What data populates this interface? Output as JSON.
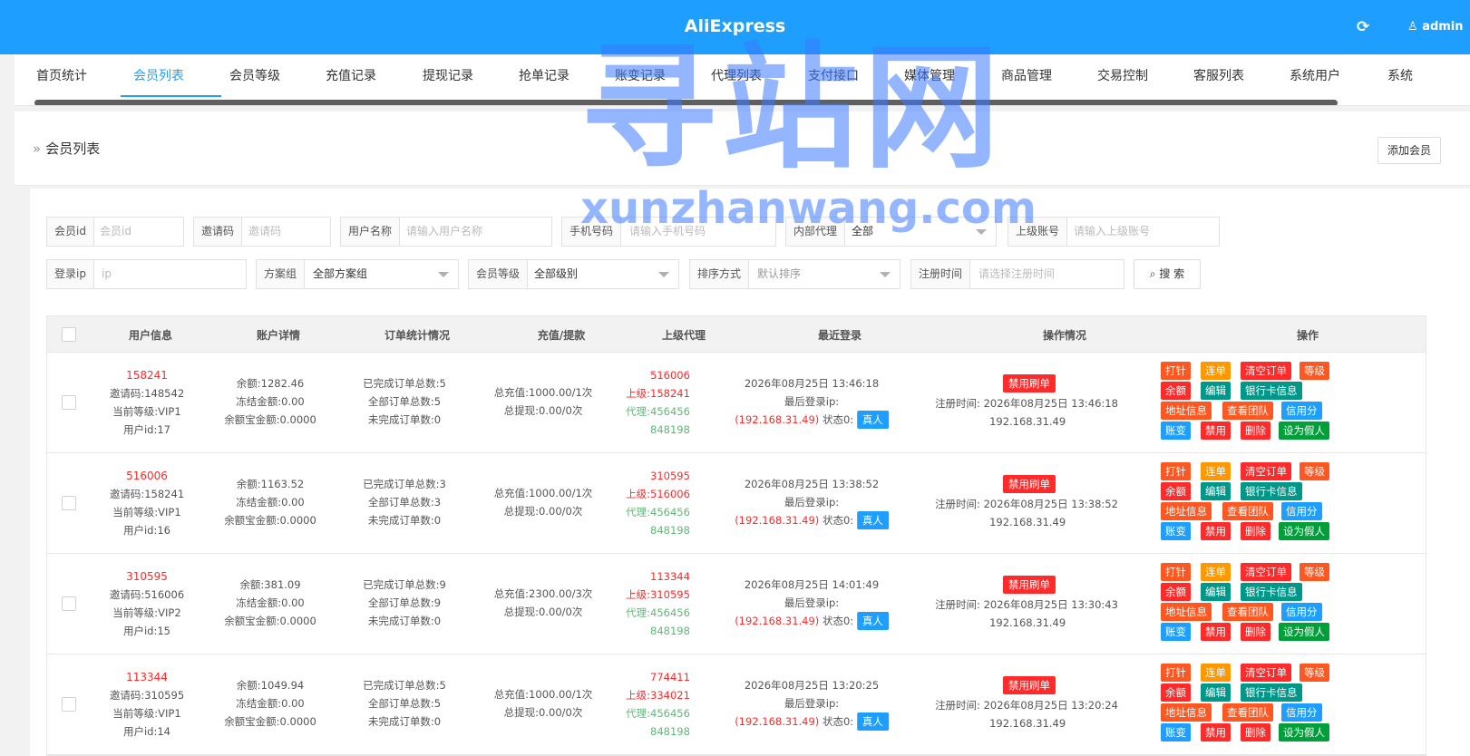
{
  "app": {
    "title": "AliExpress",
    "user": "admin",
    "refresh_icon": "refresh-icon",
    "user_icon": "user-icon"
  },
  "tabs": [
    "首页统计",
    "会员列表",
    "会员等级",
    "充值记录",
    "提现记录",
    "抢单记录",
    "账变记录",
    "代理列表",
    "支付接口",
    "媒体管理",
    "商品管理",
    "交易控制",
    "客服列表",
    "系统用户",
    "系统"
  ],
  "active_tab": "会员列表",
  "page": {
    "breadcrumb": "会员列表",
    "add_button": "添加会员"
  },
  "filters": {
    "member_id": {
      "label": "会员id",
      "placeholder": "会员id"
    },
    "invite_code": {
      "label": "邀请码",
      "placeholder": "邀请码"
    },
    "username": {
      "label": "用户名称",
      "placeholder": "请输入用户名称"
    },
    "phone": {
      "label": "手机号码",
      "placeholder": "请输入手机号码"
    },
    "internal_agent": {
      "label": "内部代理",
      "value": "全部"
    },
    "parent_account": {
      "label": "上级账号",
      "placeholder": "请输入上级账号"
    },
    "login_ip": {
      "label": "登录ip",
      "placeholder": "ip"
    },
    "plan_group": {
      "label": "方案组",
      "value": "全部方案组"
    },
    "member_level": {
      "label": "会员等级",
      "value": "全部级别"
    },
    "sort": {
      "label": "排序方式",
      "value": "默认排序"
    },
    "register_time": {
      "label": "注册时间",
      "placeholder": "请选择注册时间"
    },
    "search_button": "搜 索"
  },
  "columns": [
    "用户信息",
    "账户详情",
    "订单统计情况",
    "充值/提款",
    "上级代理",
    "最近登录",
    "操作情况",
    "操作"
  ],
  "labels": {
    "parent": "上级:",
    "agent": "代理:",
    "last_login_ip": "最后登录ip:",
    "status": "状态0:",
    "real": "真人",
    "ban_brush": "禁用刷单",
    "register_time": "注册时间:"
  },
  "actions": [
    "打针",
    "连单",
    "清空订单",
    "等级",
    "余额",
    "编辑",
    "银行卡信息",
    "地址信息",
    "查看团队",
    "信用分",
    "账变",
    "禁用",
    "删除",
    "设为假人"
  ],
  "rows": [
    {
      "uid": "158241",
      "invite": "邀请码:148542",
      "level": "当前等级:VIP1",
      "user_id": "用户id:17",
      "balance": "余额:1282.46",
      "frozen": "冻结金额:0.00",
      "yuebao": "余额宝金额:0.0000",
      "done": "已完成订单总数:5",
      "total": "全部订单总数:5",
      "undone": "未完成订单数:0",
      "recharge": "总充值:1000.00/1次",
      "withdraw": "总提现:0.00/0次",
      "parent1": "516006",
      "parent2": "158241",
      "agent1": "456456",
      "agent2": "848198",
      "login_time": "2026年08月25日 13:46:18",
      "ip": "(192.168.31.49)",
      "reg_time": "2026年08月25日 13:46:18",
      "reg_ip": "192.168.31.49"
    },
    {
      "uid": "516006",
      "invite": "邀请码:158241",
      "level": "当前等级:VIP1",
      "user_id": "用户id:16",
      "balance": "余额:1163.52",
      "frozen": "冻结金额:0.00",
      "yuebao": "余额宝金额:0.0000",
      "done": "已完成订单总数:3",
      "total": "全部订单总数:3",
      "undone": "未完成订单数:0",
      "recharge": "总充值:1000.00/1次",
      "withdraw": "总提现:0.00/0次",
      "parent1": "310595",
      "parent2": "516006",
      "agent1": "456456",
      "agent2": "848198",
      "login_time": "2026年08月25日 13:38:52",
      "ip": "(192.168.31.49)",
      "reg_time": "2026年08月25日 13:38:52",
      "reg_ip": "192.168.31.49"
    },
    {
      "uid": "310595",
      "invite": "邀请码:516006",
      "level": "当前等级:VIP2",
      "user_id": "用户id:15",
      "balance": "余额:381.09",
      "frozen": "冻结金额:0.00",
      "yuebao": "余额宝金额:0.0000",
      "done": "已完成订单总数:9",
      "total": "全部订单总数:9",
      "undone": "未完成订单数:0",
      "recharge": "总充值:2300.00/3次",
      "withdraw": "总提现:0.00/0次",
      "parent1": "113344",
      "parent2": "310595",
      "agent1": "456456",
      "agent2": "848198",
      "login_time": "2026年08月25日 14:01:49",
      "ip": "(192.168.31.49)",
      "reg_time": "2026年08月25日 13:30:43",
      "reg_ip": "192.168.31.49"
    },
    {
      "uid": "113344",
      "invite": "邀请码:310595",
      "level": "当前等级:VIP1",
      "user_id": "用户id:14",
      "balance": "余额:1049.94",
      "frozen": "冻结金额:0.00",
      "yuebao": "余额宝金额:0.0000",
      "done": "已完成订单总数:5",
      "total": "全部订单总数:5",
      "undone": "未完成订单数:0",
      "recharge": "总充值:1000.00/1次",
      "withdraw": "总提现:0.00/0次",
      "parent1": "774411",
      "parent2": "334021",
      "agent1": "456456",
      "agent2": "848198",
      "login_time": "2026年08月25日 13:20:25",
      "ip": "(192.168.31.49)",
      "reg_time": "2026年08月25日 13:20:24",
      "reg_ip": "192.168.31.49"
    }
  ],
  "watermark": {
    "big": "寻站网",
    "small": "xunzhanwang.com"
  }
}
